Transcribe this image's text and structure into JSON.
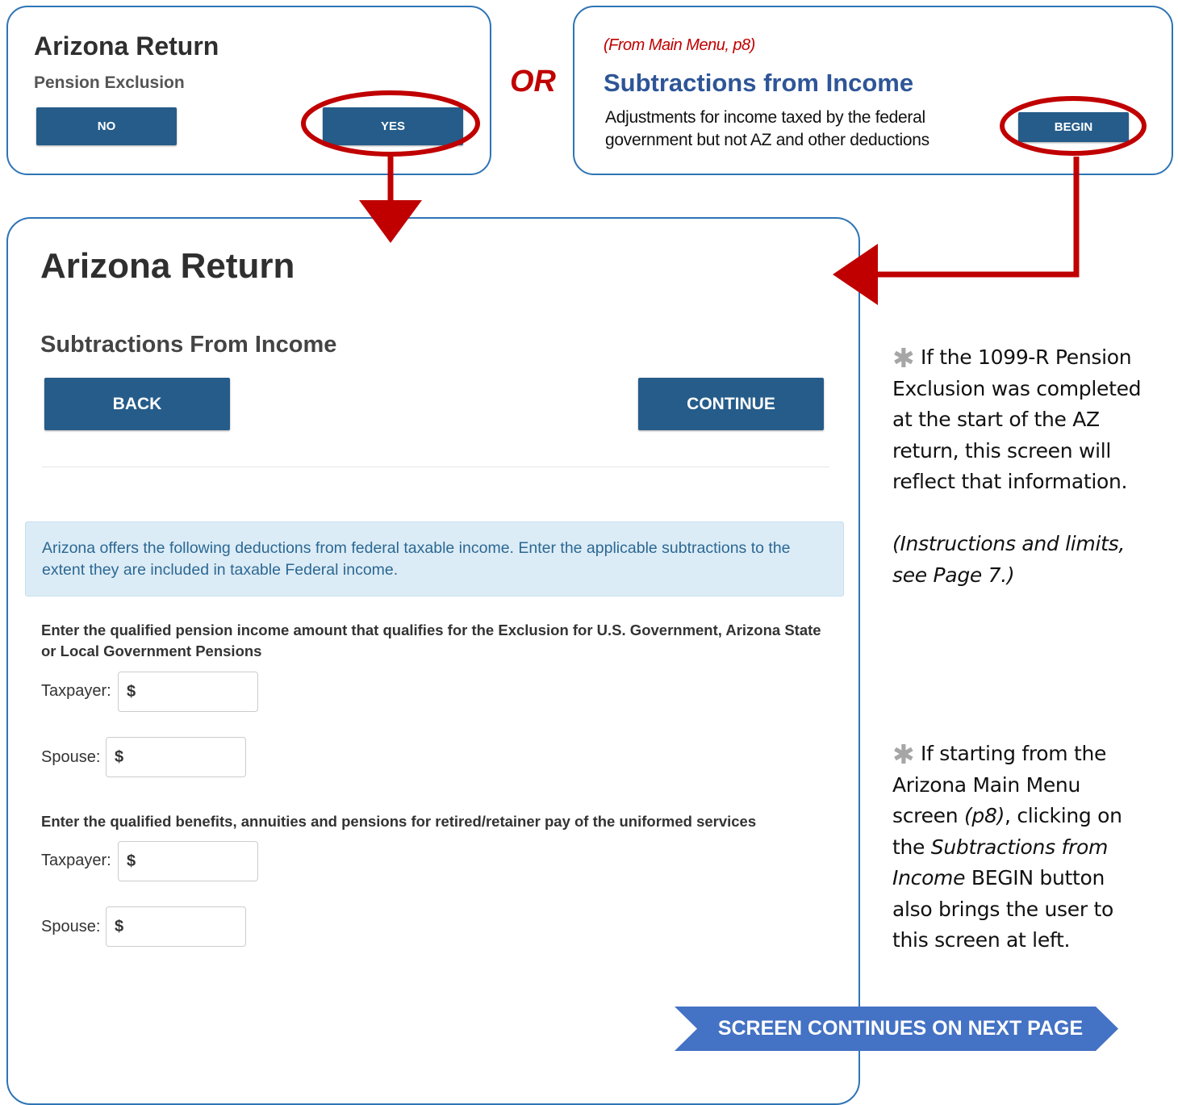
{
  "pension_panel": {
    "title": "Arizona Return",
    "subtitle": "Pension Exclusion",
    "no_label": "NO",
    "yes_label": "YES"
  },
  "or_label": "OR",
  "menu_panel": {
    "note": "(From Main Menu, p8)",
    "title": "Subtractions from Income",
    "description": "Adjustments for income taxed by the federal government but not AZ and other deductions",
    "begin_label": "BEGIN"
  },
  "main": {
    "title": "Arizona Return",
    "subtitle": "Subtractions From Income",
    "back_label": "BACK",
    "continue_label": "CONTINUE",
    "info_text": "Arizona offers the following deductions from federal taxable income. Enter the applicable subtractions to the extent they are included in taxable Federal income.",
    "question1": "Enter the qualified pension income amount that qualifies for the Exclusion for U.S. Government, Arizona State or Local Government Pensions",
    "question2": "Enter the qualified benefits, annuities and pensions for retired/retainer pay of the uniformed services",
    "taxpayer_label": "Taxpayer:",
    "spouse_label": "Spouse:",
    "currency_symbol": "$",
    "q1_taxpayer_value": "",
    "q1_spouse_value": "",
    "q2_taxpayer_value": "",
    "q2_spouse_value": ""
  },
  "sidebar_notes": {
    "note1": "If the 1099-R Pension Exclusion was completed at the start of the AZ return, this screen will reflect that information.",
    "note1_ref": "(Instructions and limits, see Page 7.)",
    "note2_a": "If starting from the Arizona Main Menu screen ",
    "note2_b": "(p8)",
    "note2_c": ", clicking on the ",
    "note2_d": "Subtractions from Income",
    "note2_e": " BEGIN button also brings the user to this screen at left."
  },
  "banner": {
    "text": "SCREEN CONTINUES ON NEXT PAGE"
  },
  "colors": {
    "button_blue": "#255c8a",
    "panel_border": "#2e74b5",
    "callout_red": "#c00000",
    "banner_blue": "#4472c4",
    "info_bg": "#dcecf6"
  },
  "icons": [
    "asterisk-icon",
    "arrow-down-icon",
    "arrow-left-icon",
    "highlight-ellipse-icon"
  ]
}
